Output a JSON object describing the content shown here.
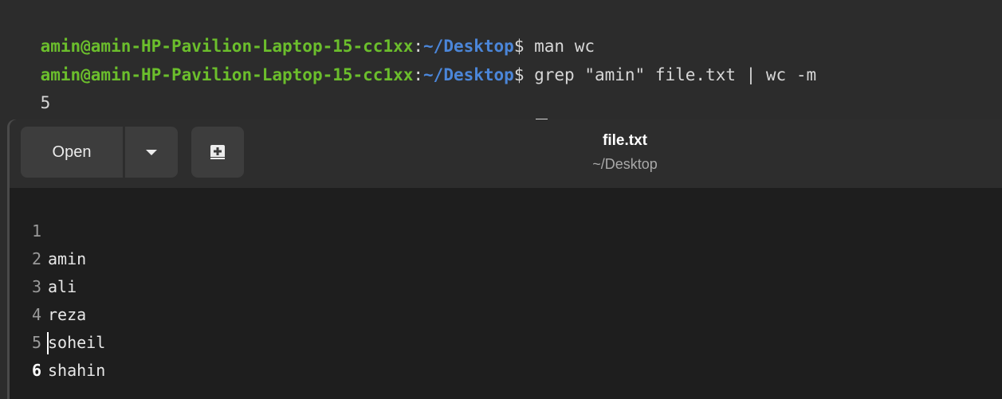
{
  "terminal": {
    "prompt": {
      "user_host": "amin@amin-HP-Pavilion-Laptop-15-cc1xx",
      "colon": ":",
      "path": "~/Desktop",
      "dollar": "$"
    },
    "lines": [
      {
        "command": " man wc"
      },
      {
        "command": " grep \"amin\" file.txt | wc -m"
      },
      {
        "output": "5"
      },
      {
        "command": " "
      }
    ]
  },
  "editor": {
    "header": {
      "open_label": "Open",
      "title": "file.txt",
      "subtitle": "~/Desktop"
    },
    "lines": [
      {
        "number": "1",
        "text": "amin"
      },
      {
        "number": "2",
        "text": "ali"
      },
      {
        "number": "3",
        "text": "reza"
      },
      {
        "number": "4",
        "text": "soheil"
      },
      {
        "number": "5",
        "text": "shahin"
      },
      {
        "number": "6",
        "text": ""
      }
    ]
  },
  "colors": {
    "prompt_user": "#6bbe2c",
    "prompt_path": "#4b86d9",
    "terminal_bg": "#2c2c2c",
    "editor_bg": "#1e1e1e",
    "headerbar_bg": "#2d2d2d"
  },
  "icons": {
    "open_menu": "chevron-down-icon",
    "new_tab": "new-tab-icon"
  }
}
